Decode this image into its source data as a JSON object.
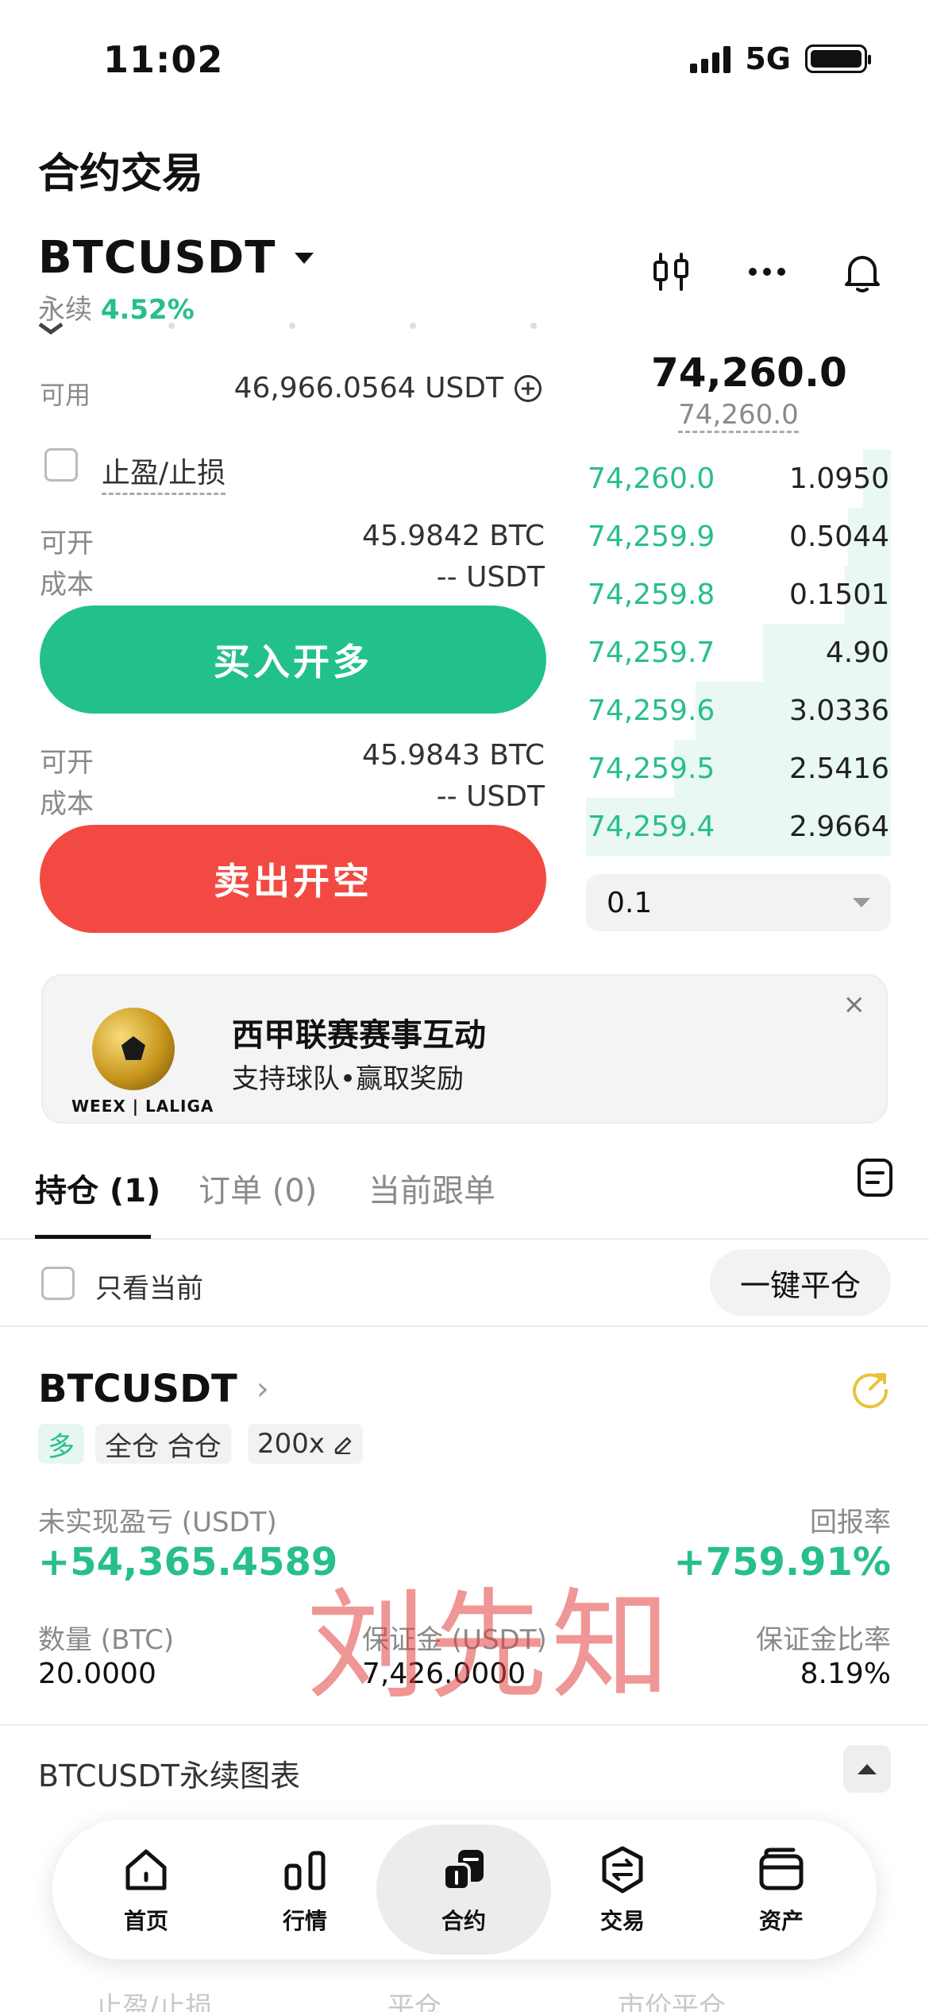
{
  "status": {
    "time": "11:02",
    "network": "5G"
  },
  "page": {
    "title": "合约交易"
  },
  "header": {
    "symbol": "BTCUSDT",
    "type": "永续",
    "change": "4.52%"
  },
  "order": {
    "available_label": "可用",
    "available_value": "46,966.0564 USDT",
    "tpsl_label": "止盈/止损",
    "buy": {
      "open_label": "可开",
      "open_value": "45.9842 BTC",
      "cost_label": "成本",
      "cost_value": "-- USDT",
      "button": "买入开多"
    },
    "sell": {
      "open_label": "可开",
      "open_value": "45.9843 BTC",
      "cost_label": "成本",
      "cost_value": "-- USDT",
      "button": "卖出开空"
    }
  },
  "orderbook": {
    "last_price": "74,260.0",
    "mark_price": "74,260.0",
    "depth": "0.1",
    "bids": [
      {
        "price": "74,260.0",
        "qty": "1.0950",
        "depth": 0.09
      },
      {
        "price": "74,259.9",
        "qty": "0.5044",
        "depth": 0.14
      },
      {
        "price": "74,259.8",
        "qty": "0.1501",
        "depth": 0.15
      },
      {
        "price": "74,259.7",
        "qty": "4.90",
        "depth": 0.42
      },
      {
        "price": "74,259.6",
        "qty": "3.0336",
        "depth": 0.64
      },
      {
        "price": "74,259.5",
        "qty": "2.5416",
        "depth": 0.71
      },
      {
        "price": "74,259.4",
        "qty": "2.9664",
        "depth": 1.0
      }
    ]
  },
  "banner": {
    "title": "西甲联赛赛事互动",
    "subtitle": "支持球队•赢取奖励",
    "brand": "WEEX | LALIGA",
    "close": "×"
  },
  "tabs": [
    {
      "label": "持仓 (1)"
    },
    {
      "label": "订单 (0)"
    },
    {
      "label": "当前跟单"
    }
  ],
  "positions": {
    "only_current": "只看当前",
    "close_all": "一键平仓",
    "item": {
      "symbol": "BTCUSDT",
      "side": "多",
      "mode": "全仓 合仓",
      "leverage": "200x",
      "upnl_label": "未实现盈亏 (USDT)",
      "upnl_value": "+54,365.4589",
      "roe_label": "回报率",
      "roe_value": "+759.91%",
      "qty_label": "数量 (BTC)",
      "qty_value": "20.0000",
      "margin_label": "保证金 (USDT)",
      "margin_value": "7,426.0000",
      "margin_ratio_label": "保证金比率",
      "margin_ratio_value": "8.19%"
    }
  },
  "watermark": "刘先知",
  "chart_section": {
    "title": "BTCUSDT永续图表"
  },
  "peek": {
    "tpsl": "止盈/止损",
    "close": "平仓",
    "market_close": "市价平仓"
  },
  "nav": [
    {
      "label": "首页",
      "icon": "home-icon"
    },
    {
      "label": "行情",
      "icon": "market-icon"
    },
    {
      "label": "合约",
      "icon": "futures-icon"
    },
    {
      "label": "交易",
      "icon": "exchange-icon"
    },
    {
      "label": "资产",
      "icon": "wallet-icon"
    }
  ],
  "colors": {
    "green": "#22c18a",
    "red": "#f24a42",
    "accent_yellow": "#e8c23a"
  }
}
